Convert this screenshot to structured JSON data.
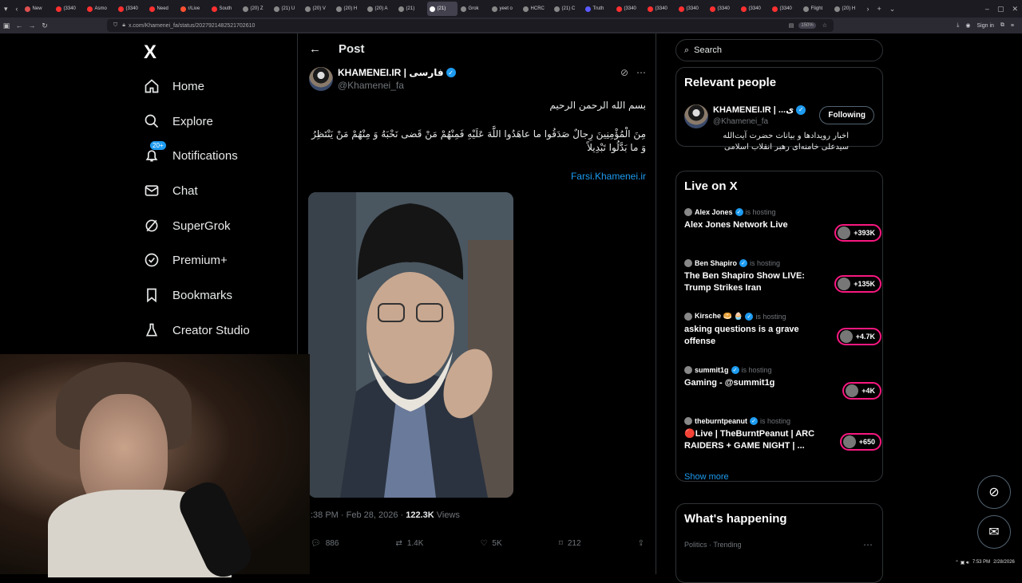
{
  "browser": {
    "tabs": [
      {
        "label": "New",
        "color": "#e05050"
      },
      {
        "label": "(3340",
        "color": "#ff3030"
      },
      {
        "label": "Asmo",
        "color": "#ff3030"
      },
      {
        "label": "(3340",
        "color": "#ff3030"
      },
      {
        "label": "Need",
        "color": "#ff3030"
      },
      {
        "label": "r/Live",
        "color": "#ff5030"
      },
      {
        "label": "South",
        "color": "#ff3030"
      },
      {
        "label": "(20) Z",
        "color": "#888888"
      },
      {
        "label": "(21) U",
        "color": "#888888"
      },
      {
        "label": "(20) V",
        "color": "#888888"
      },
      {
        "label": "(20) H",
        "color": "#888888"
      },
      {
        "label": "(20) A",
        "color": "#888888"
      },
      {
        "label": "(21)",
        "color": "#888888"
      },
      {
        "label": "(21)",
        "color": "#ffffff"
      },
      {
        "label": "Grok",
        "color": "#888888"
      },
      {
        "label": "yeet o",
        "color": "#888888"
      },
      {
        "label": "HCRC",
        "color": "#888888"
      },
      {
        "label": "(21) C",
        "color": "#888888"
      },
      {
        "label": "Truth",
        "color": "#5a5aff"
      },
      {
        "label": "(3340",
        "color": "#ff3030"
      },
      {
        "label": "(3340",
        "color": "#ff3030"
      },
      {
        "label": "(3340",
        "color": "#ff3030"
      },
      {
        "label": "(3340",
        "color": "#ff3030"
      },
      {
        "label": "(3340",
        "color": "#ff3030"
      },
      {
        "label": "(3340",
        "color": "#ff3030"
      },
      {
        "label": "Flight",
        "color": "#888888"
      },
      {
        "label": "(20) H",
        "color": "#888888"
      }
    ],
    "active_tab_index": 13,
    "url": "x.com/Khamenei_fa/status/2027921482521702610",
    "zoom": "150%",
    "sign_in": "Sign in"
  },
  "nav": {
    "logo": "X",
    "items": [
      {
        "label": "Home",
        "icon": "home-icon"
      },
      {
        "label": "Explore",
        "icon": "search-icon"
      },
      {
        "label": "Notifications",
        "icon": "bell-icon",
        "badge": "20+"
      },
      {
        "label": "Chat",
        "icon": "mail-icon"
      },
      {
        "label": "SuperGrok",
        "icon": "grok-icon"
      },
      {
        "label": "Premium+",
        "icon": "verified-icon"
      },
      {
        "label": "Bookmarks",
        "icon": "bookmark-icon"
      },
      {
        "label": "Creator Studio",
        "icon": "flask-icon"
      }
    ]
  },
  "post": {
    "header_title": "Post",
    "display_name": "KHAMENEI.IR | فارسی",
    "handle": "@Khamenei_fa",
    "bismillah": "بسم الله الرحمن الرحیم",
    "verse": "مِنَ الْمُؤْمِنِينَ رِجالٌ صَدَقُوا ما عاهَدُوا اللَّهَ عَلَيْهِ فَمِنْهُمْ مَنْ قَضى نَحْبَهُ وَ مِنْهُمْ مَنْ يَنْتَظِرُ وَ ما بَدَّلُوا تَبْدِيلاً",
    "link": "Farsi.Khamenei.ir",
    "timestamp": ":38 PM · Feb 28, 2026 · ",
    "views_count": "122.3K",
    "views_label": " Views",
    "replies": "886",
    "reposts": "1.4K",
    "likes": "5K",
    "bookmarks": "212"
  },
  "sidebar": {
    "search_placeholder": "Search",
    "relevant_title": "Relevant people",
    "relevant": {
      "name": "KHAMENEI.IR | ...ی",
      "handle": "@Khamenei_fa",
      "bio": "اخبار رویدادها و بیانات حضرت آیت‌الله سیدعلی خامنه‌ای رهبر انقلاب اسلامی",
      "follow_label": "Following"
    },
    "live_title": "Live on X",
    "is_hosting": "is hosting",
    "live": [
      {
        "host": "Alex Jones",
        "title": "Alex Jones Network Live",
        "count": "+393K"
      },
      {
        "host": "Ben Shapiro",
        "title": "The Ben Shapiro Show LIVE: Trump Strikes Iran",
        "count": "+135K"
      },
      {
        "host": "Kirsche 🥯 🧁",
        "title": "asking questions is a grave offense",
        "count": "+4.7K"
      },
      {
        "host": "summit1g",
        "title": "Gaming - @summit1g",
        "count": "+4K"
      },
      {
        "host": "theburntpeanut",
        "title": "🔴Live | TheBurntPeanut | ARC RAIDERS + GAME NIGHT | ...",
        "count": "+650"
      }
    ],
    "show_more": "Show more",
    "happening_title": "What's happening",
    "trend_meta": "Politics · Trending"
  },
  "taskbar": {
    "time": "7:53 PM",
    "date": "2/28/2026"
  }
}
